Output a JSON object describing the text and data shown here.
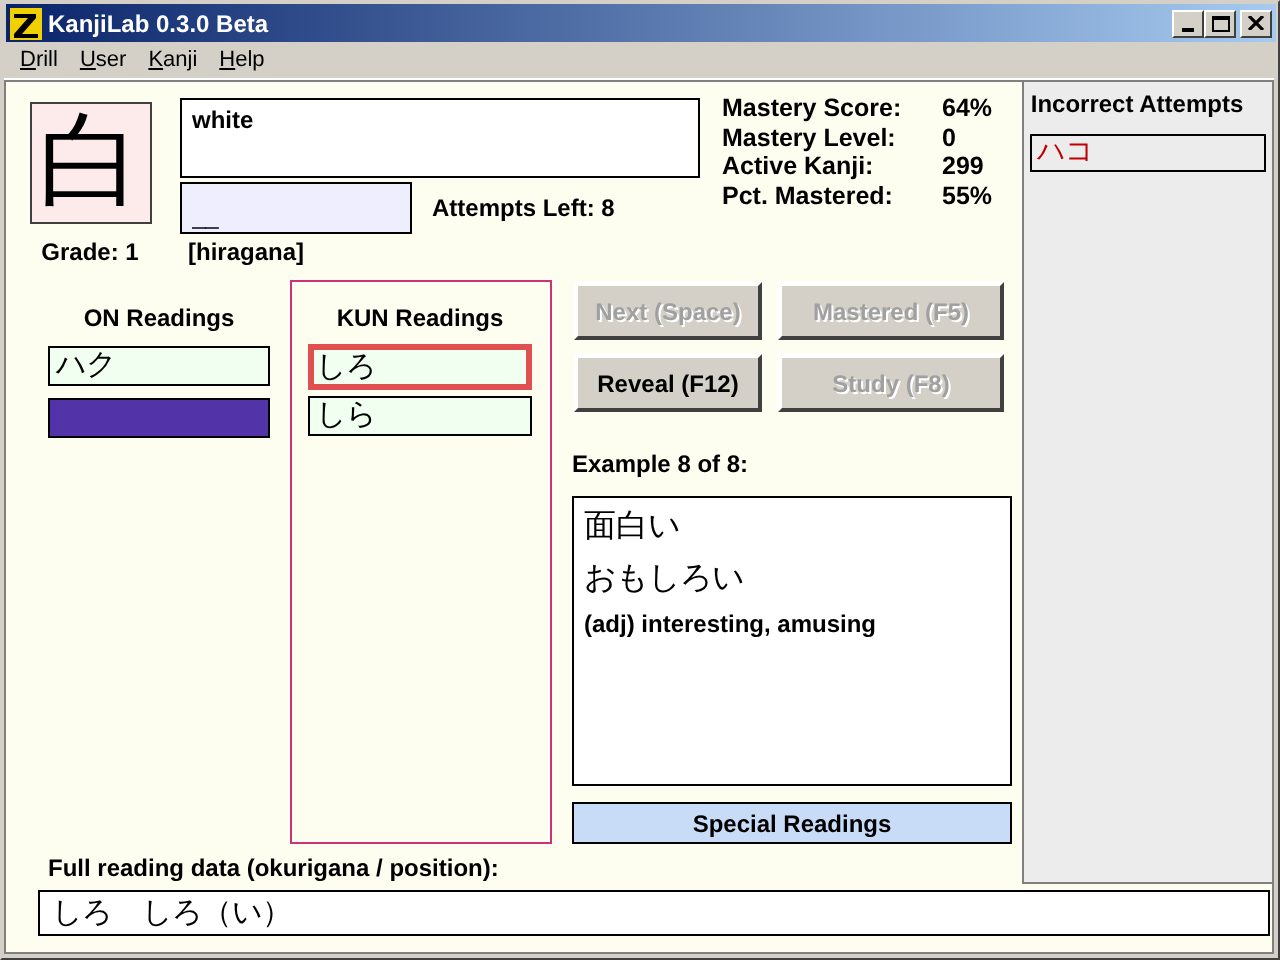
{
  "window": {
    "title": "KanjiLab 0.3.0 Beta"
  },
  "menu": [
    {
      "label": "Drill"
    },
    {
      "label": "User"
    },
    {
      "label": "Kanji"
    },
    {
      "label": "Help"
    }
  ],
  "kanji": {
    "character": "白",
    "grade": "Grade: 1"
  },
  "meaning": "white",
  "answer": {
    "value": "__",
    "hint": "[hiragana]"
  },
  "attempts_left": "Attempts Left: 8",
  "stats": [
    {
      "label": "Mastery Score:",
      "value": "64%"
    },
    {
      "label": "Mastery Level:",
      "value": "0"
    },
    {
      "label": "Active Kanji:",
      "value": "299"
    },
    {
      "label": "Pct. Mastered:",
      "value": "55%"
    }
  ],
  "on_readings": {
    "title": "ON Readings",
    "items": [
      {
        "text": "ハク",
        "selected": false,
        "focused": false
      },
      {
        "selected": true,
        "focused": false
      }
    ]
  },
  "kun_readings": {
    "title": "KUN Readings",
    "items": [
      {
        "text": "しろ",
        "selected": false,
        "focused": true
      },
      {
        "text": "しら",
        "selected": false,
        "focused": false
      }
    ]
  },
  "buttons": [
    {
      "label": "Next (Space)",
      "disabled": true
    },
    {
      "label": "Mastered (F5)",
      "disabled": true
    },
    {
      "label": "Reveal (F12)",
      "disabled": false
    },
    {
      "label": "Study (F8)",
      "disabled": true
    }
  ],
  "example": {
    "counter": "Example 8 of 8:",
    "word": "面白い",
    "reading": "おもしろい",
    "meaning": "(adj) interesting, amusing"
  },
  "special_readings": "Special Readings",
  "incorrect_attempts": {
    "title": "Incorrect Attempts",
    "items": [
      "ハコ"
    ]
  },
  "full_reading": {
    "label": "Full reading data (okurigana / position):",
    "value": "しろ　しろ（い）"
  }
}
